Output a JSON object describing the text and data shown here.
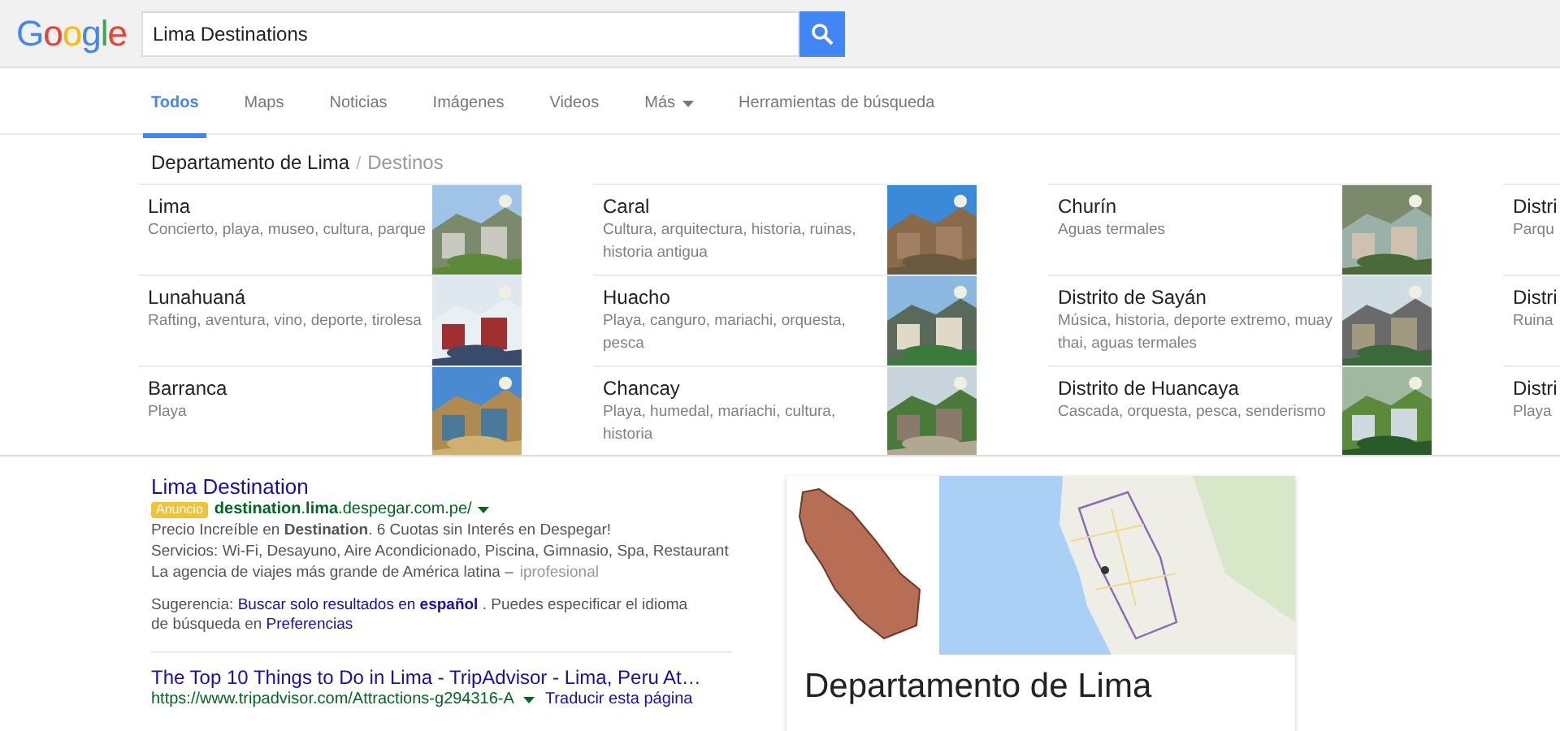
{
  "header": {
    "logo": "Google",
    "search": {
      "value": "Lima Destinations"
    }
  },
  "tabs": [
    {
      "label": "Todos",
      "selected": true
    },
    {
      "label": "Maps",
      "selected": false
    },
    {
      "label": "Noticias",
      "selected": false
    },
    {
      "label": "Imágenes",
      "selected": false
    },
    {
      "label": "Videos",
      "selected": false
    },
    {
      "label": "Más",
      "selected": false,
      "dropdown": true
    },
    {
      "label": "Herramientas de búsqueda",
      "selected": false
    }
  ],
  "breadcrumb": {
    "parent": "Departamento de Lima",
    "separator": "/",
    "current": "Destinos"
  },
  "carousel": [
    [
      {
        "title": "Lima",
        "description": "Concierto, playa, museo, cultura, parque"
      },
      {
        "title": "Lunahuaná",
        "description": "Rafting, aventura, vino, deporte, tirolesa"
      },
      {
        "title": "Barranca",
        "description": "Playa"
      }
    ],
    [
      {
        "title": "Caral",
        "description": "Cultura, arquitectura, historia, ruinas, historia antigua"
      },
      {
        "title": "Huacho",
        "description": "Playa, canguro, mariachi, orquesta, pesca"
      },
      {
        "title": "Chancay",
        "description": "Playa, humedal, mariachi, cultura, historia"
      }
    ],
    [
      {
        "title": "Churín",
        "description": "Aguas termales"
      },
      {
        "title": "Distrito de Sayán",
        "description": "Música, historia, deporte extremo, muay thai, aguas termales"
      },
      {
        "title": "Distrito de Huancaya",
        "description": "Cascada, orquesta, pesca, senderismo"
      }
    ],
    [
      {
        "title": "Distri",
        "description": "Parqu"
      },
      {
        "title": "Distri",
        "description": "Ruina"
      },
      {
        "title": "Distri",
        "description": "Playa"
      }
    ]
  ],
  "ad": {
    "title": "Lima Destination",
    "badge": "Anuncio",
    "url": "**destination**.**lima**.despegar.com.pe/",
    "lines": [
      "Precio Increíble en **Destination**. 6 Cuotas sin Interés en Despegar!",
      "Servicios: Wi-Fi, Desayuno, Aire Acondicionado, Piscina, Gimnasio, Spa, Restaurant"
    ],
    "tagline": "La agencia de viajes más grande de América latina –",
    "source": "iprofesional"
  },
  "suggestion": {
    "prefix": "Sugerencia:",
    "link": "Buscar solo resultados en **español**",
    "middle": ". Puedes especificar el idioma de búsqueda en",
    "link2": "Preferencias"
  },
  "result": {
    "title": "The Top 10 Things to Do in Lima - TripAdvisor - Lima, Peru At…",
    "url": "https://www.tripadvisor.com/Attractions-g294316-A",
    "translate": "Traducir esta página"
  },
  "knowledge_panel": {
    "title": "Departamento de Lima"
  }
}
